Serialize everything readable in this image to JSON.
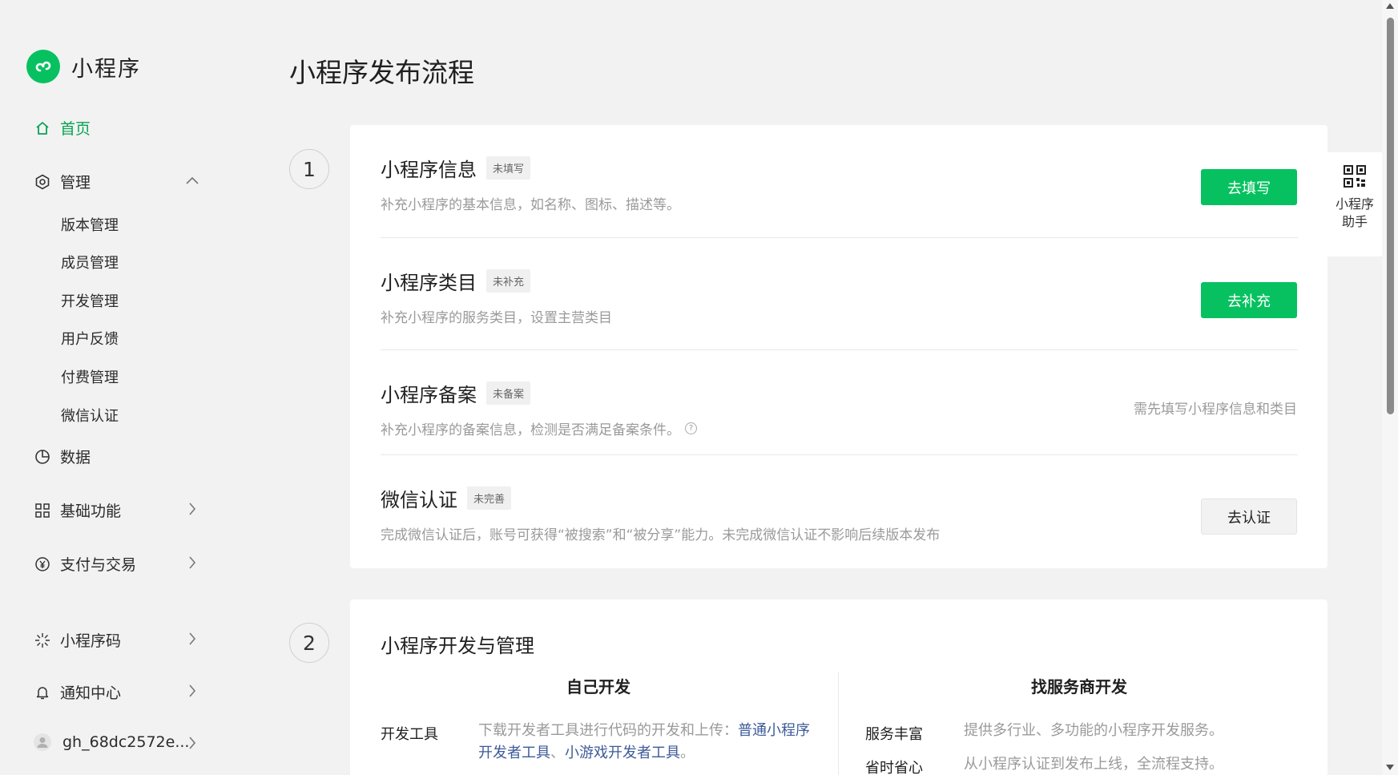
{
  "brand": {
    "title": "小程序"
  },
  "page": {
    "title": "小程序发布流程"
  },
  "sidebar": {
    "home": "首页",
    "manage": "管理",
    "manage_items": [
      "版本管理",
      "成员管理",
      "开发管理",
      "用户反馈",
      "付费管理",
      "微信认证"
    ],
    "data": "数据",
    "basic": "基础功能",
    "pay": "支付与交易",
    "qrcode": "小程序码",
    "notify": "通知中心",
    "account": "gh_68dc2572e..."
  },
  "steps": {
    "one": "1",
    "two": "2"
  },
  "publish_steps": [
    {
      "title": "小程序信息",
      "tag": "未填写",
      "desc": "补充小程序的基本信息，如名称、图标、描述等。",
      "action": "去填写"
    },
    {
      "title": "小程序类目",
      "tag": "未补充",
      "desc": "补充小程序的服务类目，设置主营类目",
      "action": "去补充"
    },
    {
      "title": "小程序备案",
      "tag": "未备案",
      "desc": "补充小程序的备案信息，检测是否满足备案条件。",
      "hint": "需先填写小程序信息和类目"
    },
    {
      "title": "微信认证",
      "tag": "未完善",
      "desc": "完成微信认证后，账号可获得“被搜索”和“被分享”能力。未完成微信认证不影响后续版本发布",
      "action": "去认证"
    }
  ],
  "dev": {
    "title": "小程序开发与管理",
    "self": {
      "heading": "自己开发",
      "tools_label": "开发工具",
      "tools_text": "下载开发者工具进行代码的开发和上传：",
      "link1": "普通小程序",
      "link1b": "开发者工具",
      "sep": "、",
      "link2": "小游戏开发者工具",
      "end": "。"
    },
    "vendor": {
      "heading": "找服务商开发",
      "rows": [
        {
          "label": "服务丰富",
          "text": "提供多行业、多功能的小程序开发服务。"
        },
        {
          "label": "省时省心",
          "text": "从小程序认证到发布上线，全流程支持。"
        }
      ]
    }
  },
  "helper": {
    "line1": "小程序",
    "line2": "助手"
  },
  "colors": {
    "accent": "#07c160",
    "link": "#3d5a99",
    "muted": "#9a9a9a"
  }
}
